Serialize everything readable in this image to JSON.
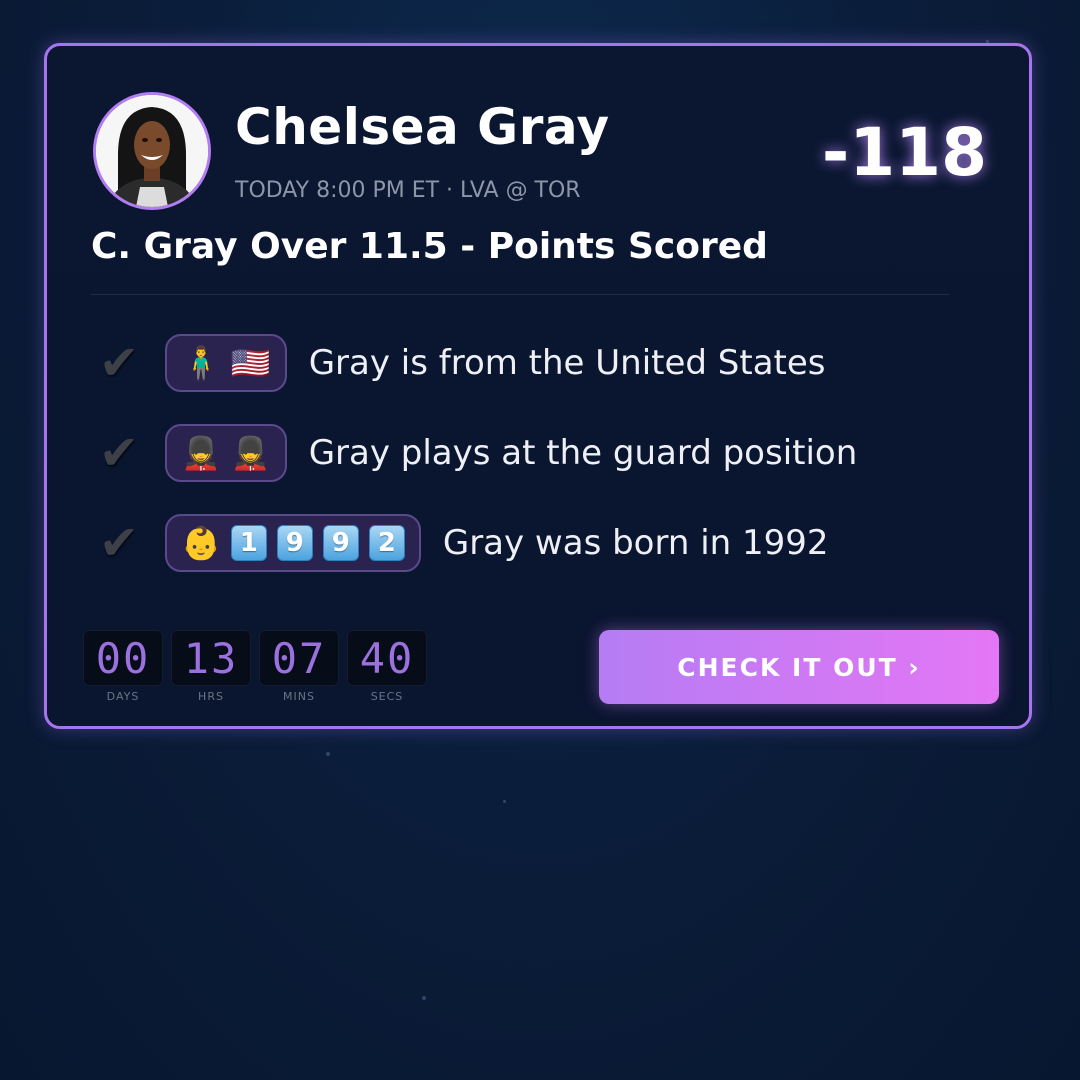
{
  "player": {
    "name": "Chelsea Gray",
    "game_info": "TODAY 8:00 PM ET · LVA @ TOR",
    "odds": "-118"
  },
  "bet": {
    "title": "C. Gray Over 11.5 - Points Scored"
  },
  "facts": [
    {
      "check": "✔",
      "emojis": [
        "🧍‍♂️",
        "🇺🇸"
      ],
      "text": "Gray is from the United States"
    },
    {
      "check": "✔",
      "emojis": [
        "💂",
        "💂"
      ],
      "text": "Gray plays at the guard position"
    },
    {
      "check": "✔",
      "emoji": "👶",
      "digits": [
        "1",
        "9",
        "9",
        "2"
      ],
      "text": "Gray was born in 1992"
    }
  ],
  "timer": {
    "days": "00",
    "hrs": "13",
    "mins": "07",
    "secs": "40",
    "labels": {
      "days": "DAYS",
      "hrs": "HRS",
      "mins": "MINS",
      "secs": "SECS"
    }
  },
  "cta": {
    "label": "CHECK IT OUT ›"
  },
  "colors": {
    "accent": "#a774f0",
    "button_start": "#b57cf3",
    "button_end": "#e477f5",
    "background": "#0a1c38"
  }
}
